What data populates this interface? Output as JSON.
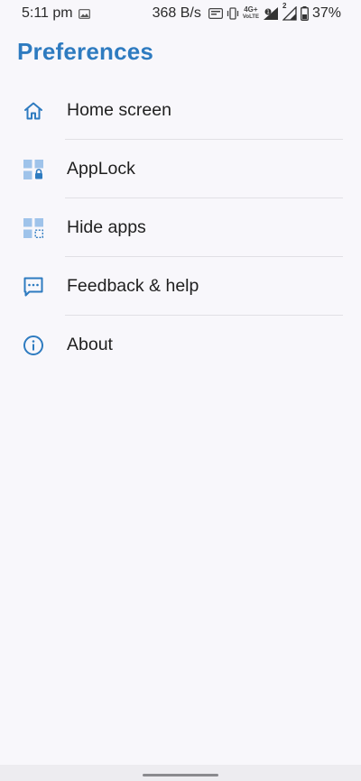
{
  "status_bar": {
    "time": "5:11 pm",
    "network_speed": "368 B/s",
    "network_label": "4G+",
    "sim2_label": "2",
    "battery": "37%",
    "icons": [
      "gallery-notification-icon",
      "nfc-icon",
      "vibrate-icon",
      "volte-icon",
      "signal-icon",
      "battery-icon"
    ]
  },
  "page": {
    "title": "Preferences"
  },
  "menu": {
    "accent_color": "#2E7BC0",
    "items": [
      {
        "label": "Home screen",
        "icon": "home-icon"
      },
      {
        "label": "AppLock",
        "icon": "app-lock-icon"
      },
      {
        "label": "Hide apps",
        "icon": "hide-apps-icon"
      },
      {
        "label": "Feedback & help",
        "icon": "feedback-icon"
      },
      {
        "label": "About",
        "icon": "info-icon"
      }
    ]
  }
}
